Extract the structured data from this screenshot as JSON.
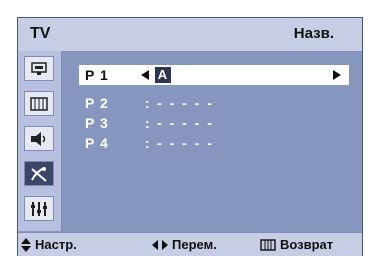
{
  "header": {
    "tv_label": "TV",
    "title": "Назв."
  },
  "sidebar": {
    "icons": [
      {
        "name": "input-icon",
        "glyph": "▭"
      },
      {
        "name": "picture-icon",
        "glyph": "▥"
      },
      {
        "name": "sound-icon",
        "glyph": "◀)"
      },
      {
        "name": "channel-icon",
        "glyph": "✕"
      },
      {
        "name": "setup-icon",
        "glyph": "⋮⋮"
      }
    ],
    "active_index": 3
  },
  "rows": [
    {
      "label": "P 1",
      "colon": "",
      "value": "",
      "char": "A",
      "selected": true
    },
    {
      "label": "P 2",
      "colon": ":",
      "value": "- - - - -"
    },
    {
      "label": "P 3",
      "colon": ":",
      "value": "- - - - -"
    },
    {
      "label": "P 4",
      "colon": ":",
      "value": "- - - - -"
    }
  ],
  "footer": {
    "adjust_label": "Настр.",
    "move_label": "Перем.",
    "return_label": "Возврат"
  },
  "colors": {
    "panel": "#8796bf",
    "bars": "#c8cde6",
    "active_icon": "#3b4669"
  }
}
